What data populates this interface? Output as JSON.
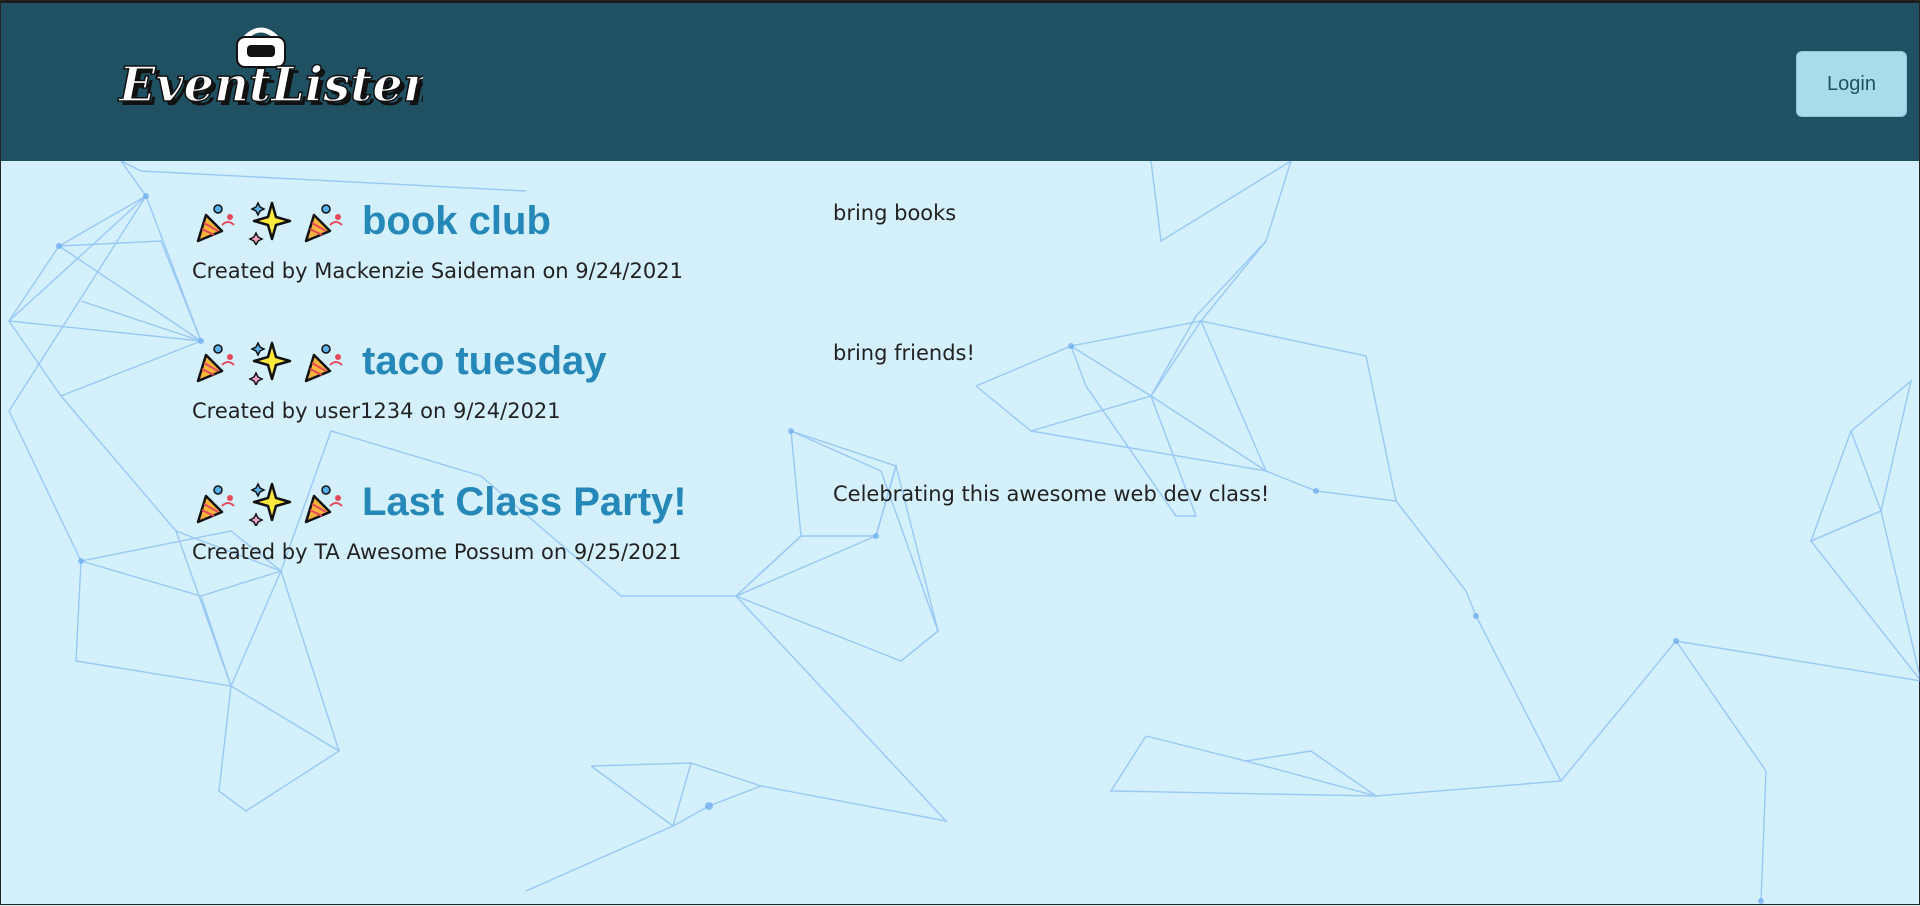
{
  "app": {
    "logo_text": "EventListener"
  },
  "header": {
    "login_label": "Login"
  },
  "events": [
    {
      "title": "book club",
      "creator": "Mackenzie Saideman",
      "date": "9/24/2021",
      "created_line": "Created by Mackenzie Saideman on 9/24/2021",
      "description": "bring books"
    },
    {
      "title": "taco tuesday",
      "creator": "user1234",
      "date": "9/24/2021",
      "created_line": "Created by user1234 on 9/24/2021",
      "description": "bring friends!"
    },
    {
      "title": "Last Class Party!",
      "creator": "TA Awesome Possum",
      "date": "9/25/2021",
      "created_line": "Created by TA Awesome Possum on 9/25/2021",
      "description": "Celebrating this awesome web dev class!"
    }
  ],
  "icons": [
    "party-popper-icon",
    "sparkles-icon",
    "party-popper-icon"
  ],
  "colors": {
    "header_bg": "#1f5163",
    "page_bg": "#d4f0fc",
    "title_color": "#2588b8",
    "login_bg": "#a7dceb",
    "network_lines": "#6aa8f0"
  }
}
